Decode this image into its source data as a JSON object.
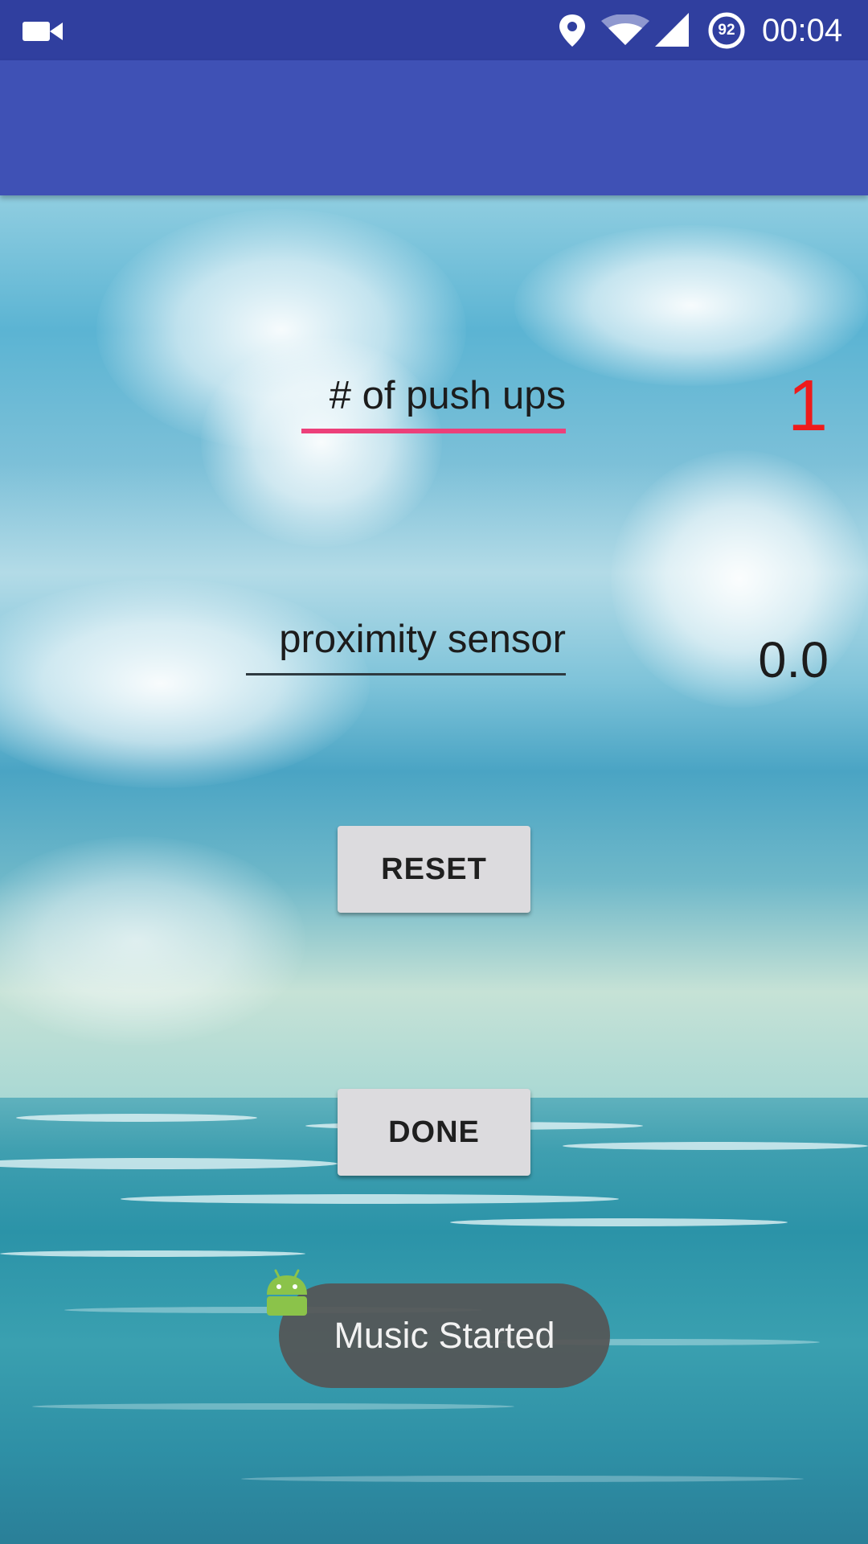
{
  "status_bar": {
    "battery_level": "92",
    "time": "00:04",
    "icons": [
      "video-icon",
      "location-icon",
      "wifi-icon",
      "signal-icon",
      "battery-icon"
    ]
  },
  "app_bar": {
    "title": ""
  },
  "fields": {
    "pushups": {
      "label": "# of push ups",
      "value": "1"
    },
    "proximity": {
      "label": "proximity sensor",
      "value": "0.0"
    }
  },
  "buttons": {
    "reset": "RESET",
    "done": "DONE"
  },
  "toast": {
    "message": "Music Started",
    "icon": "android-icon"
  },
  "colors": {
    "status_bar": "#303f9f",
    "app_bar": "#3f51b5",
    "accent": "#ec407a",
    "count_value": "#ee1b1b",
    "button": "#dcdbde"
  }
}
